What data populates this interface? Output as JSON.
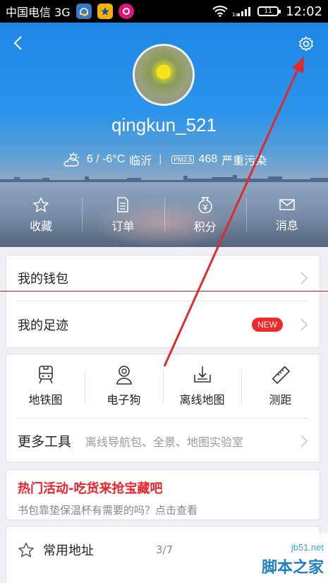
{
  "status_bar": {
    "carrier": "中国电信 3G",
    "battery": "11",
    "time": "12:02"
  },
  "header": {
    "username": "qingkun_521",
    "weather": {
      "temperature": "6 / -6°C",
      "city": "临沂",
      "separator": "|",
      "pm_label": "PM2.5",
      "aqi_value": "468",
      "aqi_text": "严重污染"
    },
    "quick_actions": [
      {
        "label": "收藏",
        "icon": "star-icon"
      },
      {
        "label": "订单",
        "icon": "order-icon"
      },
      {
        "label": "积分",
        "icon": "points-icon"
      },
      {
        "label": "消息",
        "icon": "mail-icon"
      }
    ]
  },
  "menu": {
    "wallet": "我的钱包",
    "footprints": "我的足迹",
    "new_badge": "NEW"
  },
  "tools": {
    "items": [
      {
        "label": "地铁图",
        "icon": "subway-icon"
      },
      {
        "label": "电子狗",
        "icon": "e-dog-icon"
      },
      {
        "label": "离线地图",
        "icon": "offline-map-icon"
      },
      {
        "label": "测距",
        "icon": "ruler-icon"
      }
    ],
    "more_title": "更多工具",
    "more_desc": "离线导航包、全景、地图实验室"
  },
  "promo": {
    "title": "热门活动-吃货来抢宝藏吧",
    "desc": "书包靠垫保温杯有需要的吗？点击查看"
  },
  "common_address": {
    "label": "常用地址",
    "count": "3/7"
  },
  "watermark": {
    "url": "jb51.net",
    "name": "脚本之家"
  },
  "colors": {
    "accent_red": "#e8242a",
    "header_blue": "#1f86e6"
  }
}
